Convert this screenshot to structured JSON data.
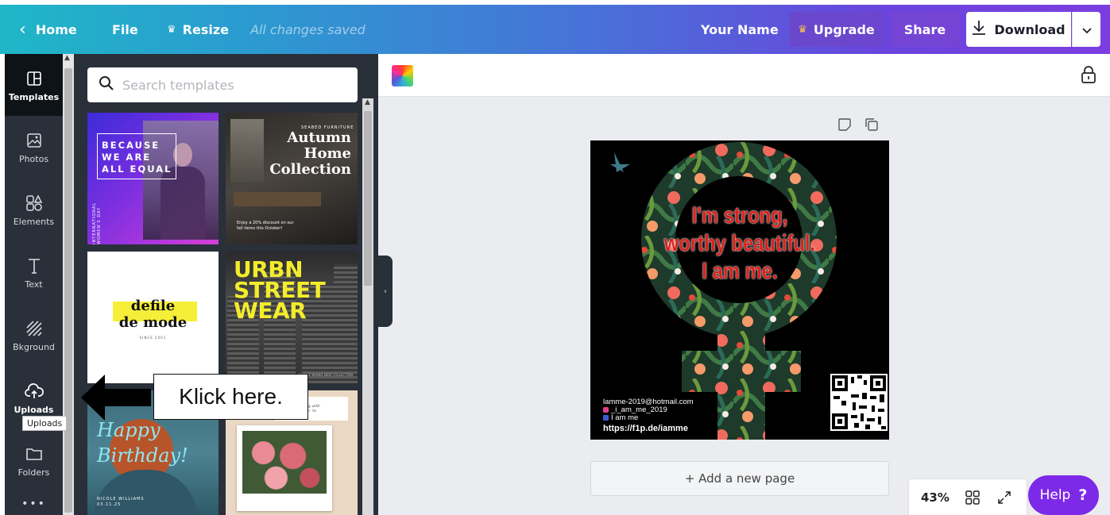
{
  "topbar": {
    "home_label": "Home",
    "file_label": "File",
    "resize_label": "Resize",
    "status": "All changes saved",
    "user_name": "Your Name",
    "upgrade_label": "Upgrade",
    "share_label": "Share",
    "download_label": "Download"
  },
  "sidebar": {
    "items": [
      {
        "label": "Templates",
        "icon": "templates-icon"
      },
      {
        "label": "Photos",
        "icon": "photos-icon"
      },
      {
        "label": "Elements",
        "icon": "elements-icon"
      },
      {
        "label": "Text",
        "icon": "text-icon"
      },
      {
        "label": "Bkground",
        "icon": "background-icon"
      },
      {
        "label": "Uploads",
        "icon": "upload-cloud-icon"
      },
      {
        "label": "Folders",
        "icon": "folder-icon"
      }
    ],
    "tooltip": "Uploads"
  },
  "panel": {
    "search_placeholder": "Search templates",
    "templates": [
      {
        "text": "BECAUSE\nWE ARE\nALL EQUAL",
        "side_text": "INTERNATIONAL WOMEN'S DAY"
      },
      {
        "small": "SEABED FURNITURE",
        "text": "Autumn\nHome\nCollection",
        "foot": "Enjoy a 20% discount on our fall items this October!"
      },
      {
        "text": "defile\nde mode",
        "since": "SINCE 2001"
      },
      {
        "text": "URBN\nSTREET\nWEAR",
        "foot": "SEE THE BRAND NEW COLLECTION"
      },
      {
        "text": "Happy\nBirthday!",
        "name": "NICOLE WILLIAMS\n03.11.25"
      },
      {
        "note": "I love to think\nof the beginning with\nthe flowers near to\nit its bloomed"
      }
    ]
  },
  "annotation": {
    "callout_text": "Klick here."
  },
  "editor": {
    "quote_lines": [
      "I'm strong,",
      "worthy beautiful.",
      "I am me."
    ],
    "contact": {
      "email": "lamme-2019@hotmail.com",
      "instagram": "_i_am_me_2019",
      "facebook": "I am me",
      "url": "https://f1p.de/iamme"
    },
    "add_page_label": "+ Add a new page",
    "zoom": "43%",
    "help_label": "Help",
    "help_symbol": "?"
  },
  "colors": {
    "accent_purple": "#7d2ae8",
    "rail_dark": "#293039",
    "quote_red": "#d8231e",
    "highlight_yellow": "#f6ef3a"
  }
}
